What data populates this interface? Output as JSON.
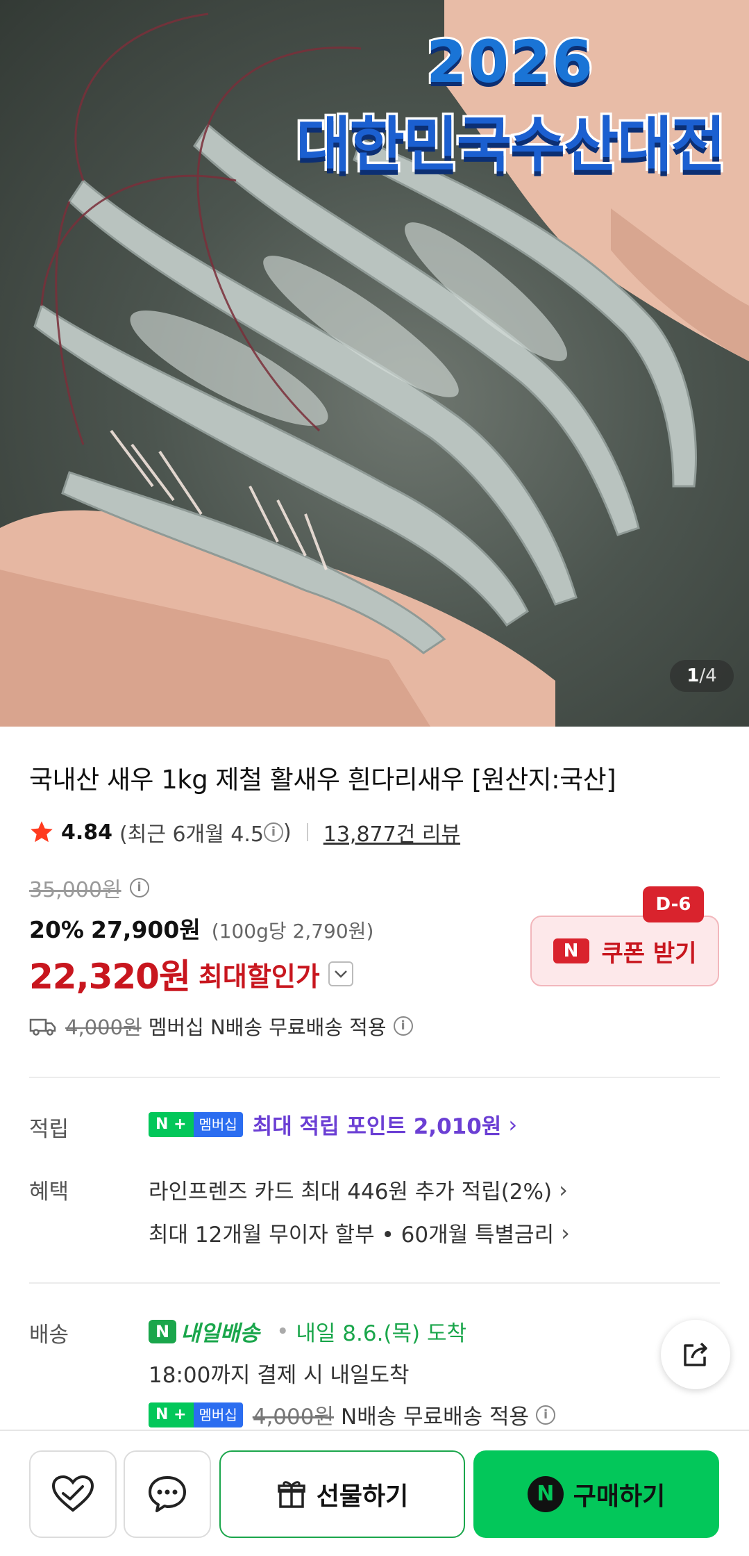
{
  "hero": {
    "banner_year": "2026",
    "banner_title": "대한민국수산대전",
    "counter_current": "1",
    "counter_sep": "/",
    "counter_total": "4"
  },
  "product": {
    "title": "국내산 새우 1kg 제철 활새우 흰다리새우 [원산지:국산]",
    "rating": "4.84",
    "recent_rating_text": "(최근 6개월 4.5",
    "recent_rating_close": ")",
    "review_count": "13,877건 리뷰",
    "original_price": "35,000원",
    "discount_percent": "20%",
    "discount_price": "27,900원",
    "unit_price": "(100g당 2,790원)",
    "final_price": "22,320원",
    "final_label": "최대할인가"
  },
  "coupon": {
    "badge": "D-6",
    "n_logo": "N",
    "label": "쿠폰 받기"
  },
  "shipping_summary": {
    "original_fee": "4,000원",
    "text": "멤버십 N배송 무료배송 적용"
  },
  "details": {
    "points_label": "적립",
    "membership_nplus": "N +",
    "membership_text": "멤버십",
    "points_text": "최대 적립 포인트 2,010원",
    "benefits_label": "혜택",
    "benefit_1": "라인프렌즈 카드 최대 446원 추가 적립(2%)",
    "benefit_2": "최대 12개월 무이자 할부 • 60개월 특별금리",
    "delivery_label": "배송",
    "tomorrow_n": "N",
    "tomorrow_label": "내일배송",
    "arrival_text": "내일 8.6.(목) 도착",
    "cutoff_text": "18:00까지 결제 시 내일도착",
    "delivery_original_fee": "4,000원",
    "delivery_free_text": "N배송 무료배송 적용"
  },
  "bottom_bar": {
    "gift_label": "선물하기",
    "buy_n": "N",
    "buy_label": "구매하기"
  },
  "colors": {
    "sale_red": "#c8161e",
    "naver_green": "#03c75a",
    "point_purple": "#6b3fd4",
    "arrival_green": "#1aa64b"
  },
  "icons": [
    "star-icon",
    "info-icon",
    "chevron-down-icon",
    "truck-icon",
    "chevron-right-icon",
    "share-icon",
    "heart-check-icon",
    "chat-icon",
    "gift-icon"
  ]
}
